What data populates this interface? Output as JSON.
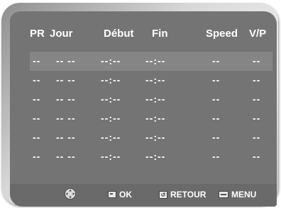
{
  "header": {
    "pr": "PR",
    "jour": "Jour",
    "debut": "Début",
    "fin": "Fin",
    "speed": "Speed",
    "vp": "V/P"
  },
  "rows": [
    {
      "pr": "--",
      "jour": "-- --",
      "debut": "--:--",
      "fin": "--:--",
      "speed": "--",
      "vp": "--"
    },
    {
      "pr": "--",
      "jour": "-- --",
      "debut": "--:--",
      "fin": "--:--",
      "speed": "--",
      "vp": "--"
    },
    {
      "pr": "--",
      "jour": "-- --",
      "debut": "--:--",
      "fin": "--:--",
      "speed": "--",
      "vp": "--"
    },
    {
      "pr": "--",
      "jour": "-- --",
      "debut": "--:--",
      "fin": "--:--",
      "speed": "--",
      "vp": "--"
    },
    {
      "pr": "--",
      "jour": "-- --",
      "debut": "--:--",
      "fin": "--:--",
      "speed": "--",
      "vp": "--"
    },
    {
      "pr": "--",
      "jour": "-- --",
      "debut": "--:--",
      "fin": "--:--",
      "speed": "--",
      "vp": "--"
    }
  ],
  "footer": {
    "navigate_icon": "four-way-arrows-icon",
    "ok_icon": "enter-icon",
    "ok_label": "OK",
    "retour_icon": "return-icon",
    "retour_label": "RETOUR",
    "menu_icon": "menu-icon",
    "menu_label": "MENU"
  },
  "colors": {
    "screen": "#747474",
    "selected_row": "#858585",
    "footer": "#6a6a6a",
    "text": "#ffffff"
  }
}
